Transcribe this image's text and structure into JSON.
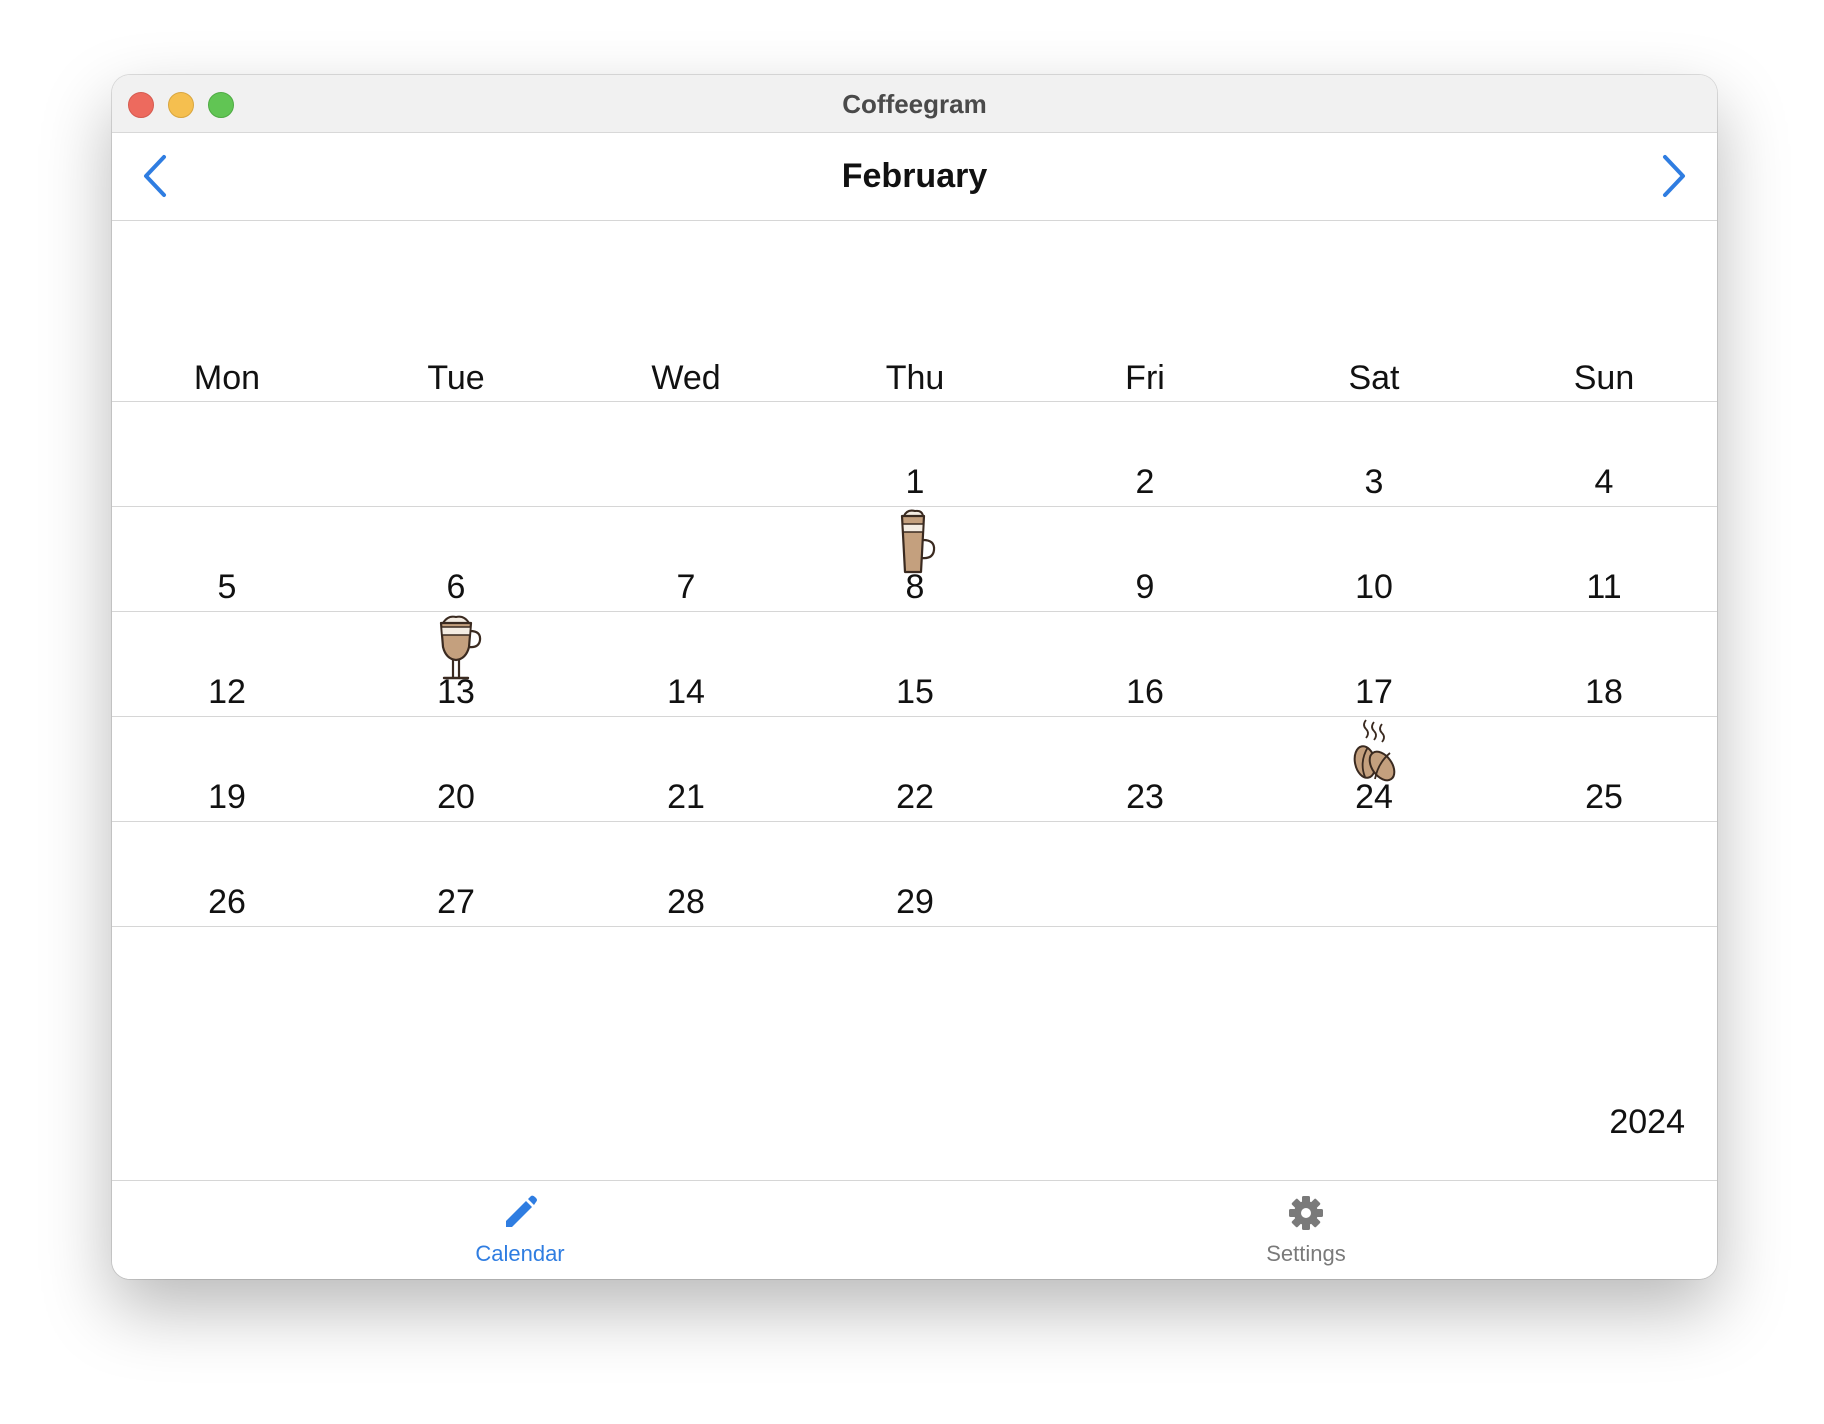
{
  "window": {
    "title": "Coffeegram"
  },
  "header": {
    "month": "February",
    "prev_icon": "chevron-left-icon",
    "next_icon": "chevron-right-icon"
  },
  "calendar": {
    "weekdays": [
      "Mon",
      "Tue",
      "Wed",
      "Thu",
      "Fri",
      "Sat",
      "Sun"
    ],
    "weeks": [
      [
        "",
        "",
        "",
        "1",
        "2",
        "3",
        "4"
      ],
      [
        "5",
        "6",
        "7",
        "8",
        "9",
        "10",
        "11"
      ],
      [
        "12",
        "13",
        "14",
        "15",
        "16",
        "17",
        "18"
      ],
      [
        "19",
        "20",
        "21",
        "22",
        "23",
        "24",
        "25"
      ],
      [
        "26",
        "27",
        "28",
        "29",
        "",
        "",
        ""
      ]
    ],
    "drinks": {
      "8": "latte-glass-icon",
      "13": "irish-coffee-icon",
      "24": "coffee-beans-icon"
    },
    "year": "2024"
  },
  "tabs": [
    {
      "label": "Calendar",
      "icon": "pencil-icon",
      "active": true
    },
    {
      "label": "Settings",
      "icon": "gear-icon",
      "active": false
    }
  ],
  "colors": {
    "accent": "#2f7de1",
    "coffee": "#c4a07e",
    "outline": "#3a2a20",
    "inactive": "#7a7a7a"
  }
}
